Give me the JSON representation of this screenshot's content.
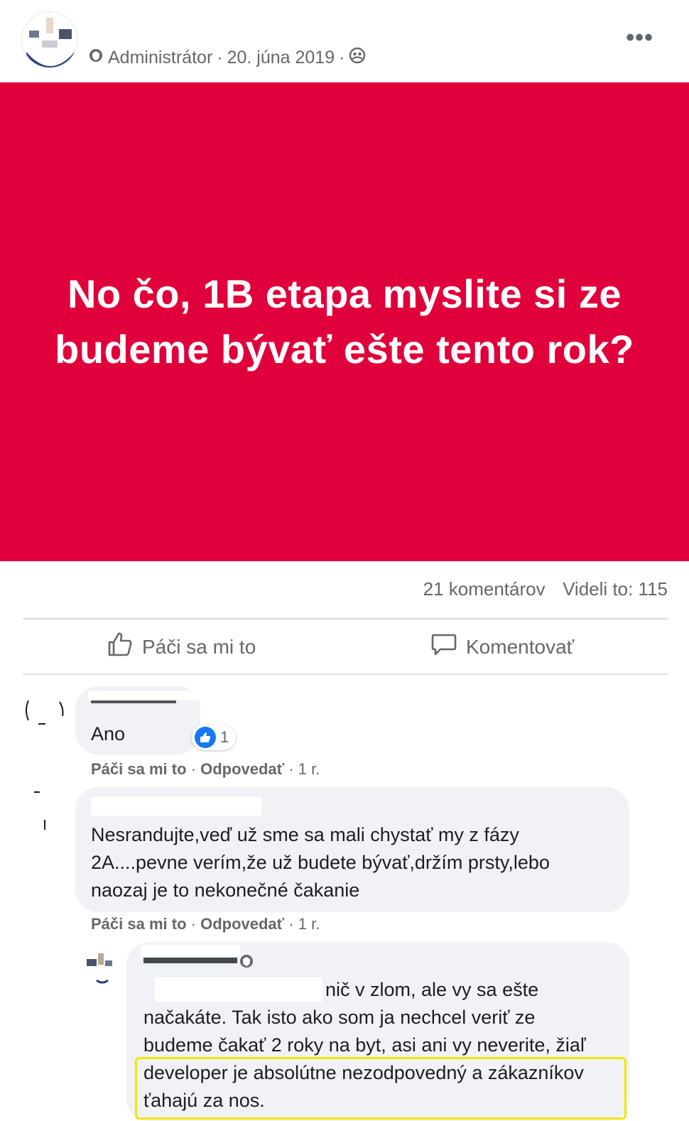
{
  "post": {
    "role": "Administrátor",
    "date": "20. júna 2019",
    "separator": "·",
    "more_label": "•••",
    "banner_text": "No čo, 1B etapa myslite si ze budeme bývať ešte tento rok?",
    "banner_color": "#e0003b"
  },
  "stats": {
    "comments": "21 komentárov",
    "views": "Videli to: 115"
  },
  "actions": {
    "like": "Páči sa mi to",
    "comment": "Komentovať"
  },
  "comments": [
    {
      "text": "Ano",
      "reaction_count": "1",
      "like": "Páči sa mi to",
      "reply": "Odpovedať",
      "time": "1 r."
    },
    {
      "text": "Nesrandujte,veď už sme sa mali chystať my z fázy 2A....pevne verím,že už budete bývať,držím prsty,lebo naozaj je to nekonečné čakanie",
      "like": "Páči sa mi to",
      "reply": "Odpovedať",
      "time": "1 r."
    },
    {
      "text_line1": "nič v zlom, ale vy sa ešte",
      "text_line2": "načakáte. Tak isto ako som ja nechcel veriť ze",
      "text_line3": "budeme čakať 2 roky na byt, asi ani vy neverite, žiaľ",
      "text_line4": "developer je absolútne nezodpovedný a zákazníkov",
      "text_line5": "ťahajú za nos."
    }
  ],
  "colors": {
    "accent": "#1877f2",
    "highlight": "#f3e600",
    "muted": "#65676b"
  }
}
